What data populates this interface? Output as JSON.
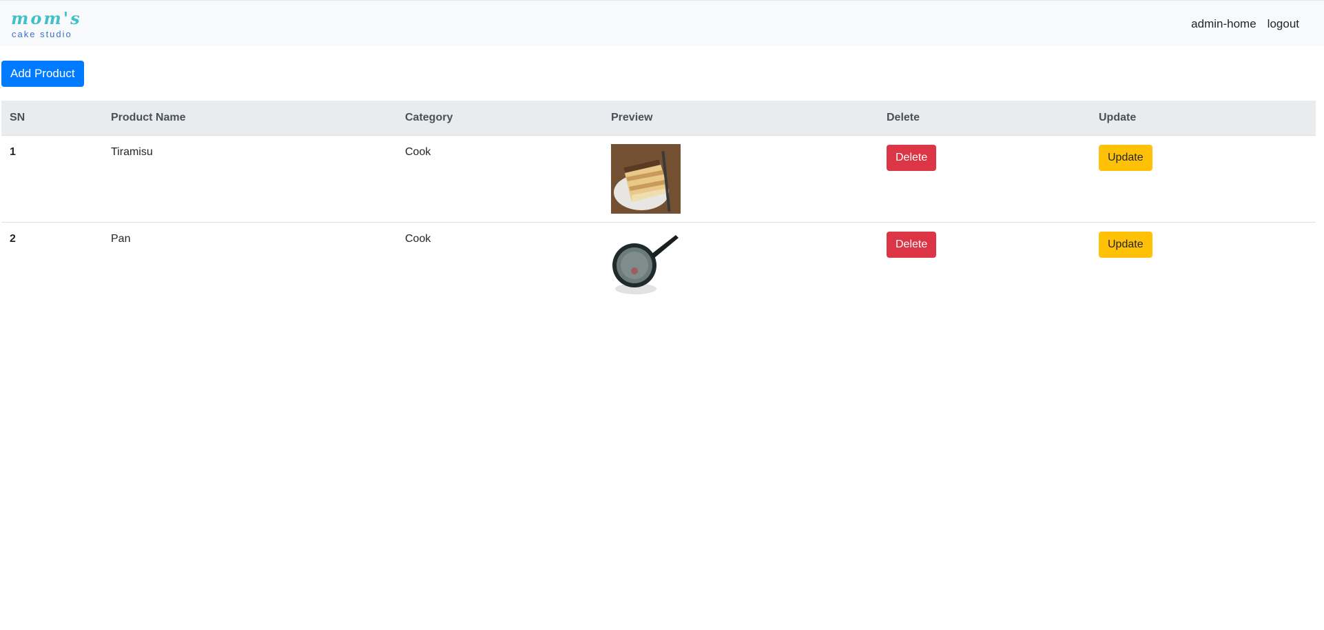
{
  "header": {
    "logo_top": "mom's",
    "logo_bottom": "cake studio",
    "nav": [
      {
        "label": "admin-home"
      },
      {
        "label": "logout"
      }
    ]
  },
  "toolbar": {
    "add_label": "Add Product"
  },
  "table": {
    "headers": {
      "sn": "SN",
      "name": "Product Name",
      "category": "Category",
      "preview": "Preview",
      "delete": "Delete",
      "update": "Update"
    },
    "rows": [
      {
        "sn": "1",
        "name": "Tiramisu",
        "category": "Cook",
        "preview_icon": "tiramisu-image",
        "delete_label": "Delete",
        "update_label": "Update"
      },
      {
        "sn": "2",
        "name": "Pan",
        "category": "Cook",
        "preview_icon": "pan-image",
        "delete_label": "Delete",
        "update_label": "Update"
      }
    ]
  },
  "colors": {
    "primary": "#007bff",
    "danger": "#dc3545",
    "warning": "#ffc107",
    "navbar_bg": "#f8f9fa",
    "thead_bg": "#e9ecef"
  }
}
